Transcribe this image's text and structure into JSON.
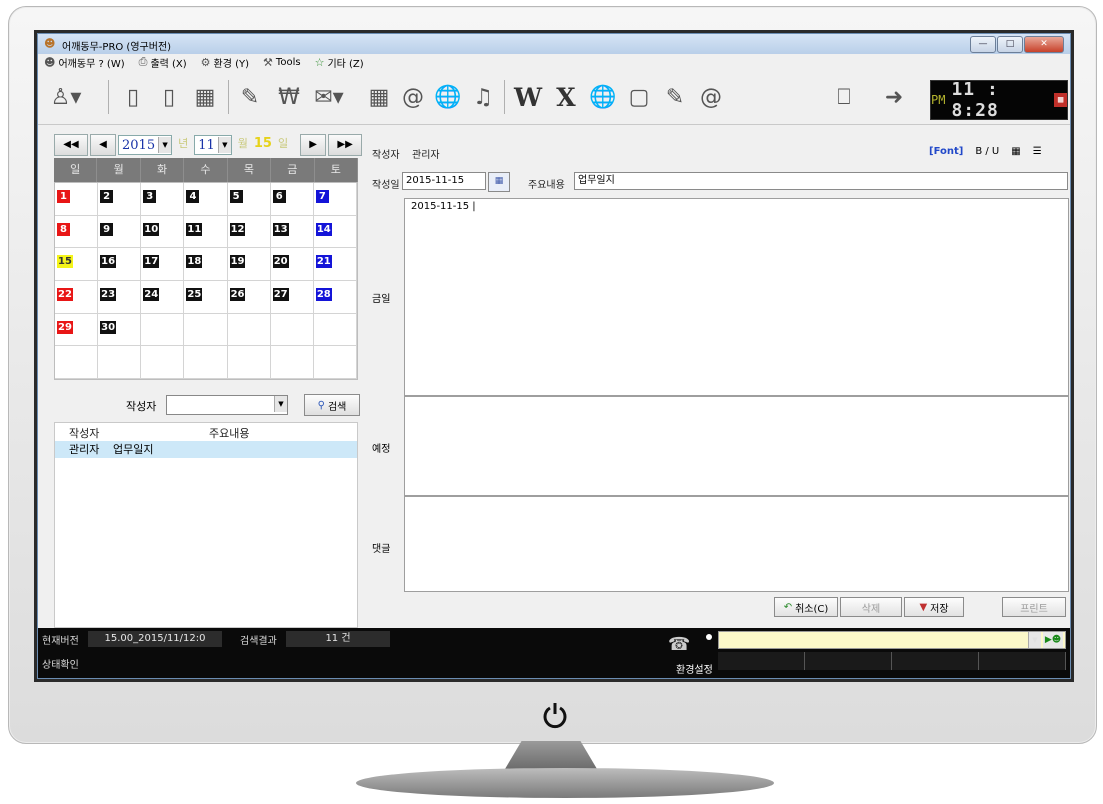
{
  "window": {
    "title": "어깨동무-PRO (영구버전)"
  },
  "menu": [
    {
      "label": "어깨동무 ? (W)",
      "icon": "user-icon"
    },
    {
      "label": "출력 (X)",
      "icon": "printer-icon"
    },
    {
      "label": "환경 (Y)",
      "icon": "gear-icon"
    },
    {
      "label": "Tools",
      "icon": "tools-icon"
    },
    {
      "label": "기타 (Z)",
      "icon": "star-icon"
    }
  ],
  "toolbar": {
    "letter_w": "W",
    "letter_x": "X",
    "clock": {
      "ampm": "PM",
      "time": "11 : 8:28"
    }
  },
  "calendar": {
    "year": "2015",
    "year_unit": "년",
    "month": "11",
    "month_unit": "월",
    "day": "15",
    "day_unit": "일",
    "nav": {
      "first": "◀◀",
      "prev": "◀",
      "next": "▶",
      "last": "▶▶"
    },
    "weekdays": [
      "일",
      "월",
      "화",
      "수",
      "목",
      "금",
      "토"
    ],
    "days": [
      "1",
      "2",
      "3",
      "4",
      "5",
      "6",
      "7",
      "8",
      "9",
      "10",
      "11",
      "12",
      "13",
      "14",
      "15",
      "16",
      "17",
      "18",
      "19",
      "20",
      "21",
      "22",
      "23",
      "24",
      "25",
      "26",
      "27",
      "28",
      "29",
      "30"
    ],
    "today": "15"
  },
  "search": {
    "writer_label": "작성자",
    "button_label": "검색"
  },
  "list": {
    "headers": [
      "작성자",
      "주요내용"
    ],
    "rows": [
      {
        "writer": "관리자",
        "content": "업무일지"
      }
    ]
  },
  "entry": {
    "writer_label": "작성자",
    "writer_value": "관리자",
    "date_label": "작성일",
    "date_value": "2015-11-15",
    "subject_label": "주요내용",
    "subject_value": "업무일지",
    "font_link": "[Font]",
    "bu": "B / U",
    "today_label": "금일",
    "today_text": "2015-11-15 |",
    "plan_label": "예정",
    "comment_label": "댓글"
  },
  "buttons": {
    "cancel": "취소(C)",
    "delete": "삭제",
    "save": "저장",
    "print": "프린트"
  },
  "status": {
    "version_label": "현재버전",
    "version_value": "15.00_2015/11/12:0",
    "result_label": "검색결과",
    "result_value": "11 건",
    "state_label": "상태확인",
    "settings_label": "환경설정"
  },
  "colors": {
    "sunday": "#e81616",
    "saturday": "#1414d8",
    "today": "#f4f41a",
    "link": "#2249c9"
  }
}
